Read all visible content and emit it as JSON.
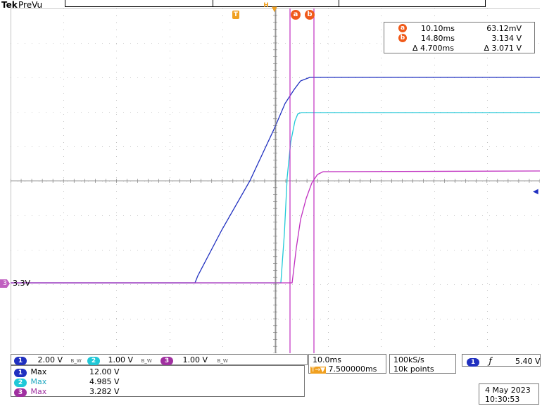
{
  "header": {
    "brand": "Tek",
    "mode": "PreVu"
  },
  "colors": {
    "ch1": "#2030c0",
    "ch2": "#20c8d8",
    "ch3": "#c030c0",
    "cursor": "#c030c0",
    "marker": "#f05a1a",
    "trigger": "#f0a020",
    "grid": "#aaaaaa"
  },
  "markers": {
    "trigger": "T",
    "horizontal": "H",
    "cursor_a": "a",
    "cursor_b": "b"
  },
  "cursor_readout": {
    "a": {
      "label": "a",
      "time": "10.10ms",
      "value": "63.12mV"
    },
    "b": {
      "label": "b",
      "time": "14.80ms",
      "value": "3.134 V"
    },
    "delta": {
      "time": "Δ 4.700ms",
      "value": "Δ 3.071 V"
    }
  },
  "ground_ref": {
    "channel": "3",
    "level": "3.3V"
  },
  "channels": [
    {
      "id": "1",
      "scale": "2.00 V",
      "bw": "B_W"
    },
    {
      "id": "2",
      "scale": "1.00 V",
      "bw": "B_W"
    },
    {
      "id": "3",
      "scale": "1.00 V",
      "bw": "B_W"
    }
  ],
  "measurements": [
    {
      "channel": "1",
      "name": "Max",
      "value": "12.00 V"
    },
    {
      "channel": "2",
      "name": "Max",
      "value": "4.985 V"
    },
    {
      "channel": "3",
      "name": "Max",
      "value": "3.282 V"
    }
  ],
  "timebase": {
    "scale": "10.0ms",
    "position": "7.500000ms",
    "position_prefix": "T→▼"
  },
  "acquisition": {
    "sample_rate": "100kS/s",
    "record_length": "10k points"
  },
  "trigger": {
    "source": "1",
    "slope": "rising-edge-icon",
    "level": "5.40 V"
  },
  "datetime": {
    "date": "4 May 2023",
    "time": "10:30:53"
  }
}
